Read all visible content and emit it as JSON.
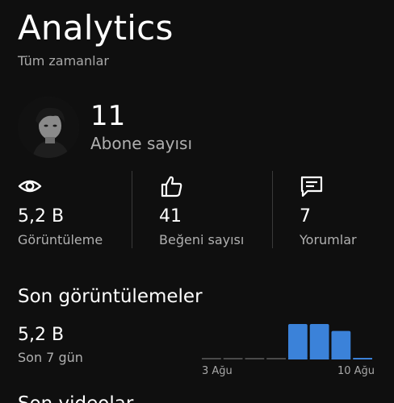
{
  "header": {
    "title": "Analytics",
    "subtitle": "Tüm zamanlar"
  },
  "channel": {
    "subscriber_count": "11",
    "subscriber_label": "Abone sayısı"
  },
  "stats": [
    {
      "icon": "eye-icon",
      "value": "5,2 B",
      "label": "Görüntüleme"
    },
    {
      "icon": "thumbs-up-icon",
      "value": "41",
      "label": "Beğeni sayısı"
    },
    {
      "icon": "comment-icon",
      "value": "7",
      "label": "Yorumlar"
    }
  ],
  "recent": {
    "title": "Son görüntülemeler",
    "value": "5,2 B",
    "label": "Son 7 gün"
  },
  "chart_data": {
    "type": "bar",
    "x_tick_labels": [
      "3 Ağu",
      "10 Ağu"
    ],
    "values": [
      0,
      0,
      0,
      0,
      1.0,
      1.0,
      0.8,
      0.02
    ],
    "bar_color": "#3b82d9",
    "baseline_color": "#4a4a4a",
    "tick_label_color": "#a8a8a8"
  },
  "next_section": {
    "title": "Son videolar"
  }
}
